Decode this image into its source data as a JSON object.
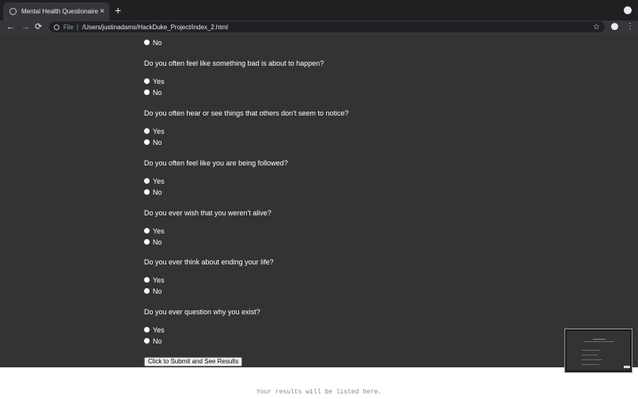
{
  "browser": {
    "tab_title": "Mental Health Questionaire",
    "tab_close": "×",
    "new_tab": "+",
    "nav": {
      "back": "←",
      "forward": "→",
      "reload": "⟳"
    },
    "scheme": "File",
    "separator": "|",
    "url": "/Users/justinadams/HackDuke_Project/index_2.html",
    "bookmark": "☆",
    "menu": "⋮"
  },
  "form": {
    "top_option": "No",
    "questions": [
      {
        "text": "Do you often feel like something bad is about to happen?",
        "yes": "Yes",
        "no": "No"
      },
      {
        "text": "Do you often hear or see things that others don't seem to notice?",
        "yes": "Yes",
        "no": "No"
      },
      {
        "text": "Do you often feel like you are being followed?",
        "yes": "Yes",
        "no": "No"
      },
      {
        "text": "Do you ever wish that you weren't alive?",
        "yes": "Yes",
        "no": "No"
      },
      {
        "text": "Do you ever think about ending your life?",
        "yes": "Yes",
        "no": "No"
      },
      {
        "text": "Do you ever question why you exist?",
        "yes": "Yes",
        "no": "No"
      }
    ],
    "submit_label": "Click to Submit and See Results"
  },
  "results_text": "Your results will be listed here."
}
